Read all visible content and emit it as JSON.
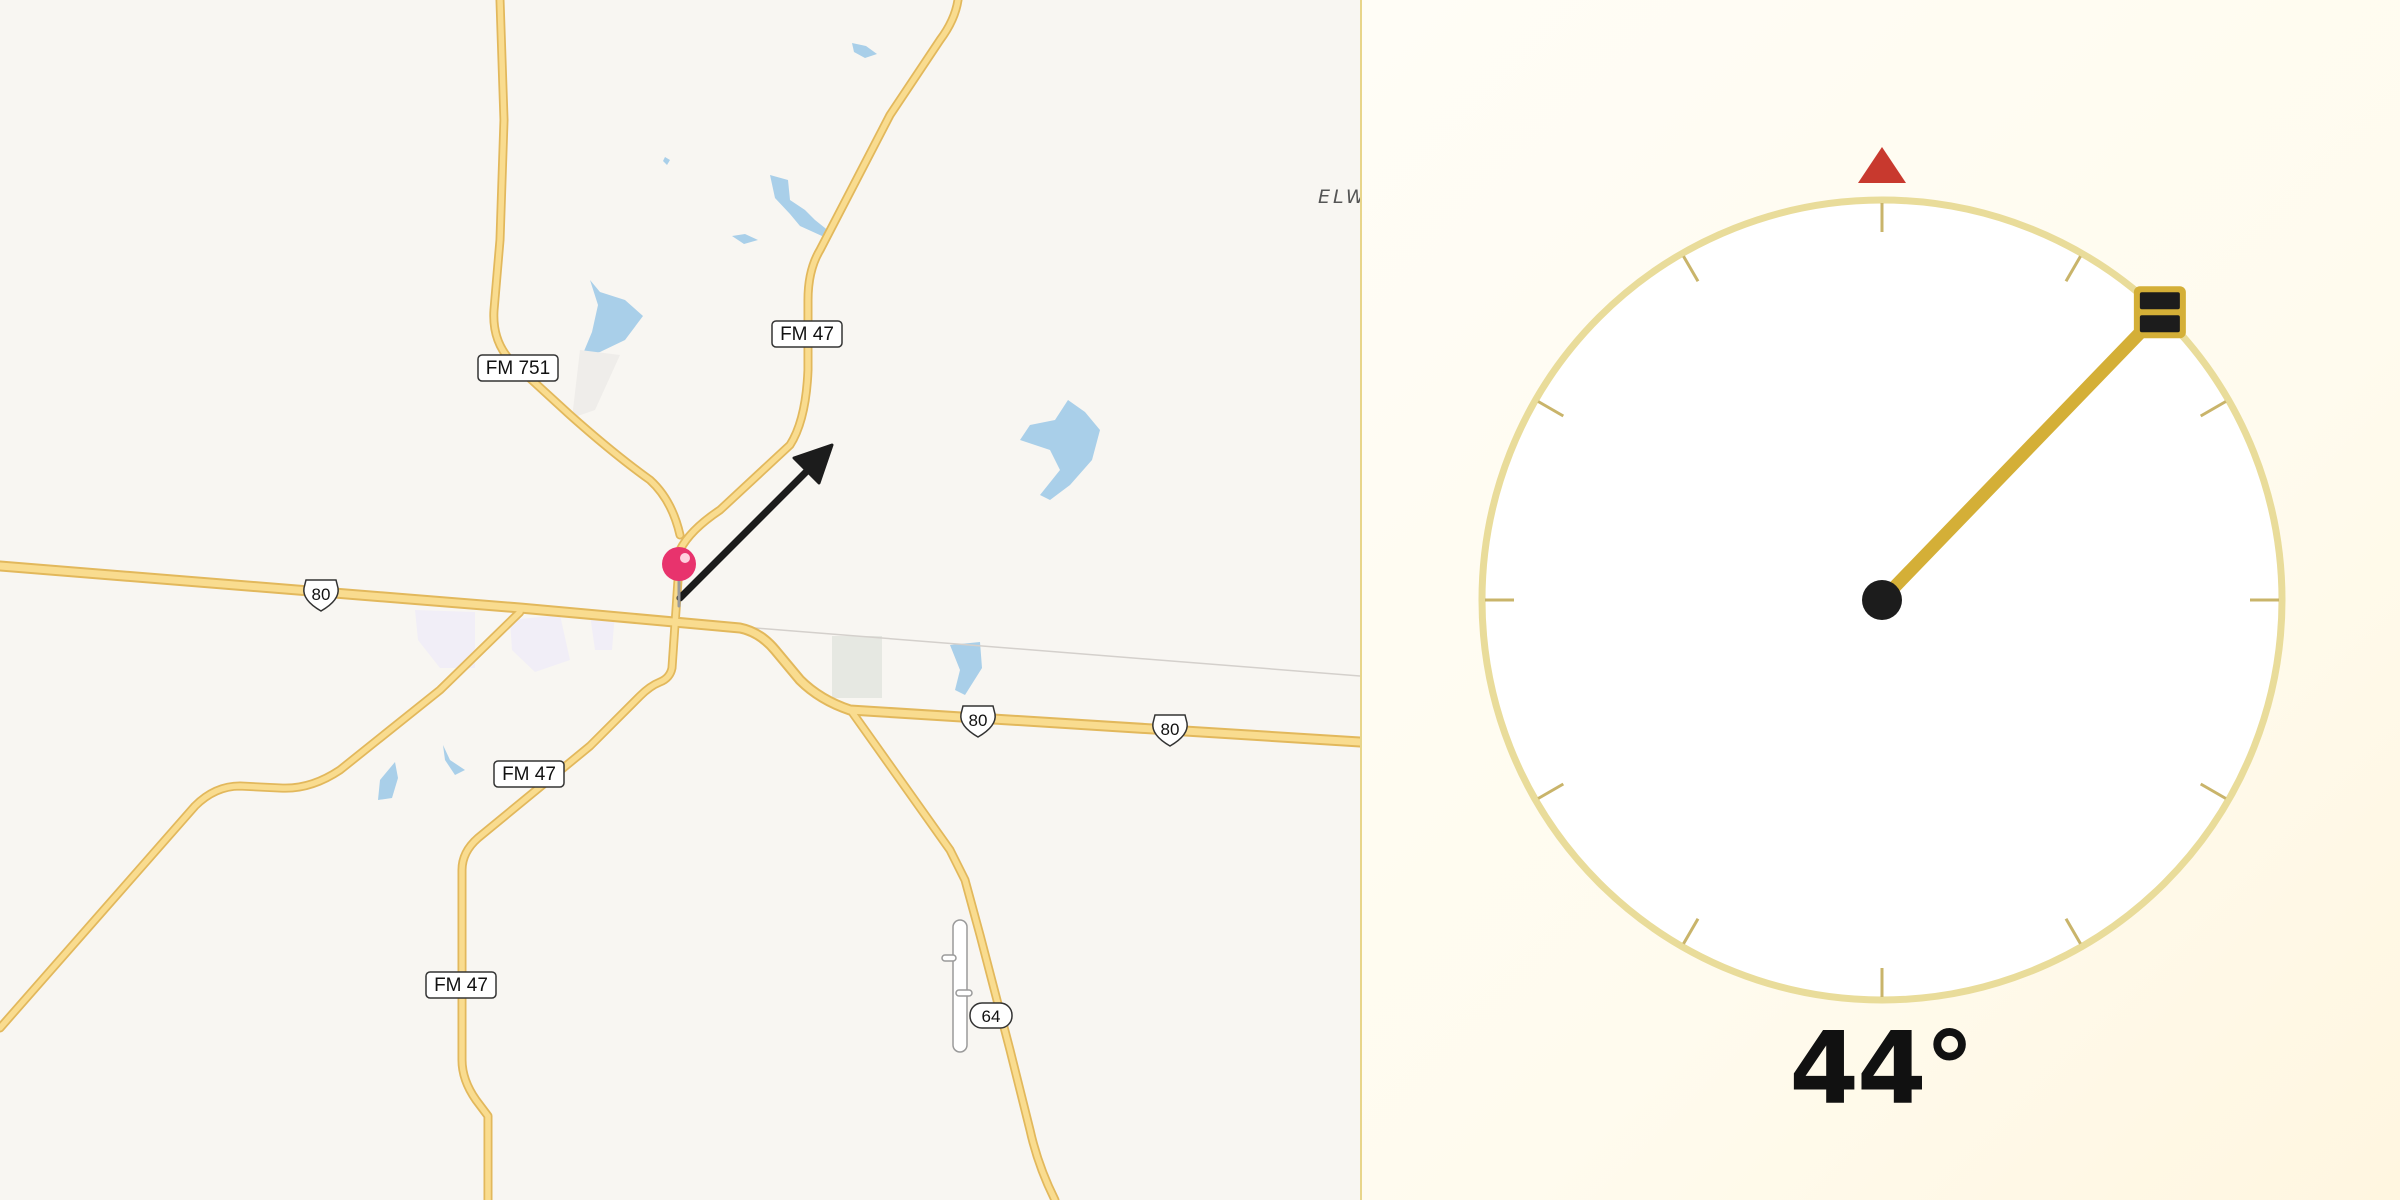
{
  "map": {
    "roads": {
      "fm751": "FM 751",
      "fm47_north": "FM 47",
      "fm47_south": "FM 47",
      "fm47_southwest": "FM 47",
      "us80_west": "80",
      "us80_east_1": "80",
      "us80_east_2": "80",
      "sh64": "64"
    },
    "place_label": "ELW",
    "pin_color": "#e8336d",
    "road_color": "#f7d37a",
    "water_color": "#a9cfe9",
    "arrow_color": "#1c1c1c"
  },
  "compass": {
    "heading_degrees": 44,
    "heading_text": "44°",
    "north_marker_color": "#c8392e",
    "needle_color": "#d4af37",
    "ring_color": "#e9dc9a"
  }
}
